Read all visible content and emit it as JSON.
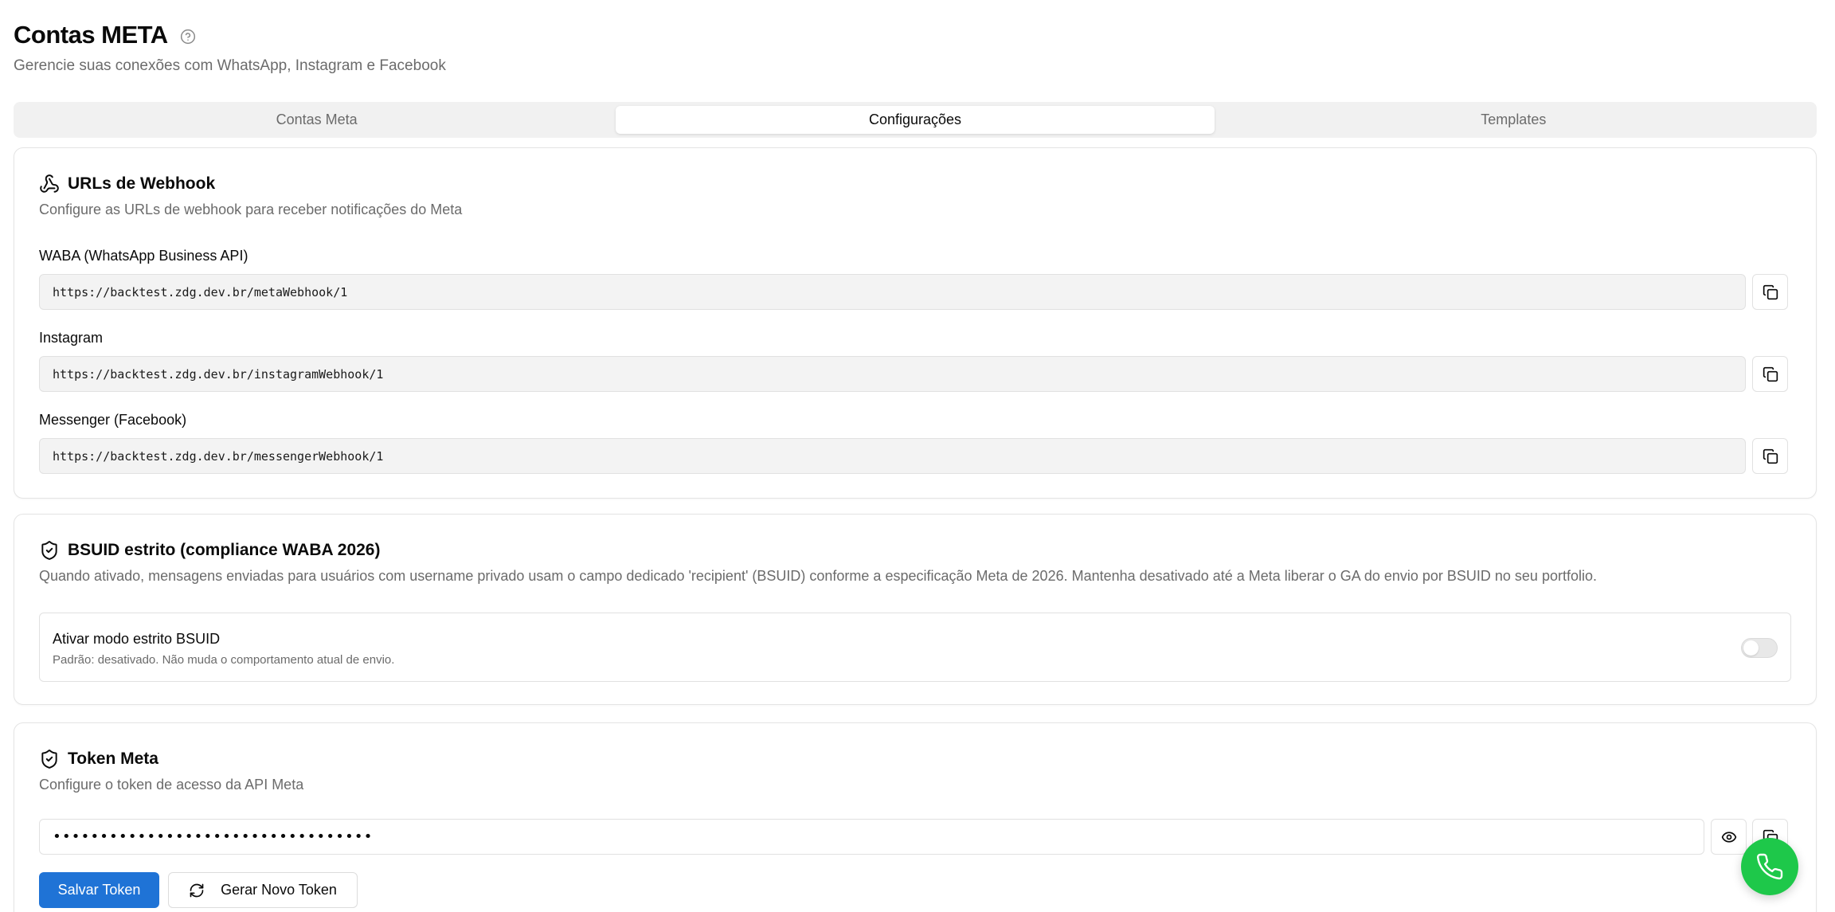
{
  "header": {
    "title": "Contas META",
    "subtitle": "Gerencie suas conexões com WhatsApp, Instagram e Facebook"
  },
  "tabs": [
    {
      "label": "Contas Meta",
      "active": false
    },
    {
      "label": "Configurações",
      "active": true
    },
    {
      "label": "Templates",
      "active": false
    }
  ],
  "webhook": {
    "title": "URLs de Webhook",
    "description": "Configure as URLs de webhook para receber notificações do Meta",
    "fields": [
      {
        "label": "WABA (WhatsApp Business API)",
        "value": "https://backtest.zdg.dev.br/metaWebhook/1"
      },
      {
        "label": "Instagram",
        "value": "https://backtest.zdg.dev.br/instagramWebhook/1"
      },
      {
        "label": "Messenger (Facebook)",
        "value": "https://backtest.zdg.dev.br/messengerWebhook/1"
      }
    ]
  },
  "bsuid": {
    "title": "BSUID estrito (compliance WABA 2026)",
    "description": "Quando ativado, mensagens enviadas para usuários com username privado usam o campo dedicado 'recipient' (BSUID) conforme a especificação Meta de 2026. Mantenha desativado até a Meta liberar o GA do envio por BSUID no seu portfolio.",
    "toggle_title": "Ativar modo estrito BSUID",
    "toggle_desc": "Padrão: desativado. Não muda o comportamento atual de envio.",
    "enabled": false
  },
  "token": {
    "title": "Token Meta",
    "description": "Configure o token de acesso da API Meta",
    "masked_value": "••••••••••••••••••••••••••••••••••",
    "save_label": "Salvar Token",
    "generate_label": "Gerar Novo Token"
  },
  "colors": {
    "primary": "#1f73d6",
    "whatsapp_fab": "#1ec84a"
  }
}
